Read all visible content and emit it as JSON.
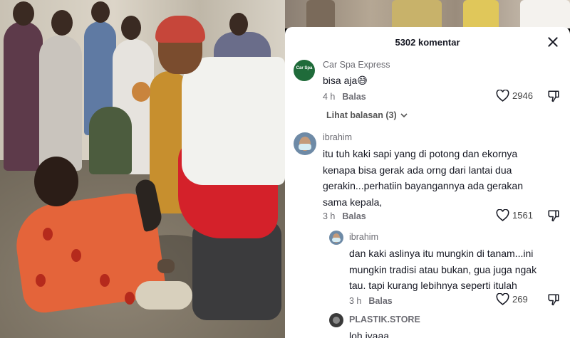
{
  "header": {
    "comment_count": "5302 komentar"
  },
  "comments": [
    {
      "author": "Car Spa Express",
      "avatar_text": "Car Spa",
      "text": "bisa aja😅",
      "time": "4 h",
      "reply_label": "Balas",
      "likes": "2946",
      "view_replies": "Lihat balasan (3)"
    },
    {
      "author": "ibrahim",
      "text_lines": [
        "itu tuh kaki sapi yang di potong dan ekornya",
        "kenapa bisa gerak ada orng dari lantai dua",
        "gerakin...perhatiin bayangannya ada gerakan",
        "sama kepala,"
      ],
      "time": "3 h",
      "reply_label": "Balas",
      "likes": "1561"
    },
    {
      "author": "ibrahim",
      "text_lines": [
        "dan kaki aslinya itu mungkin di tanam...ini",
        "mungkin tradisi atau bukan, gua juga ngak",
        "tau. tapi kurang lebihnya seperti itulah"
      ],
      "time": "3 h",
      "reply_label": "Balas",
      "likes": "269"
    },
    {
      "author": "PLASTIK.STORE",
      "text": "loh iyaaa"
    }
  ],
  "colors": {
    "panel_bg": "#ffffff",
    "text_primary": "#161823",
    "text_secondary": "#6b6b72",
    "avatar_green": "#1f6b3a"
  },
  "icons": [
    "close-icon",
    "heart-icon",
    "dislike-icon",
    "chevron-down-icon"
  ]
}
